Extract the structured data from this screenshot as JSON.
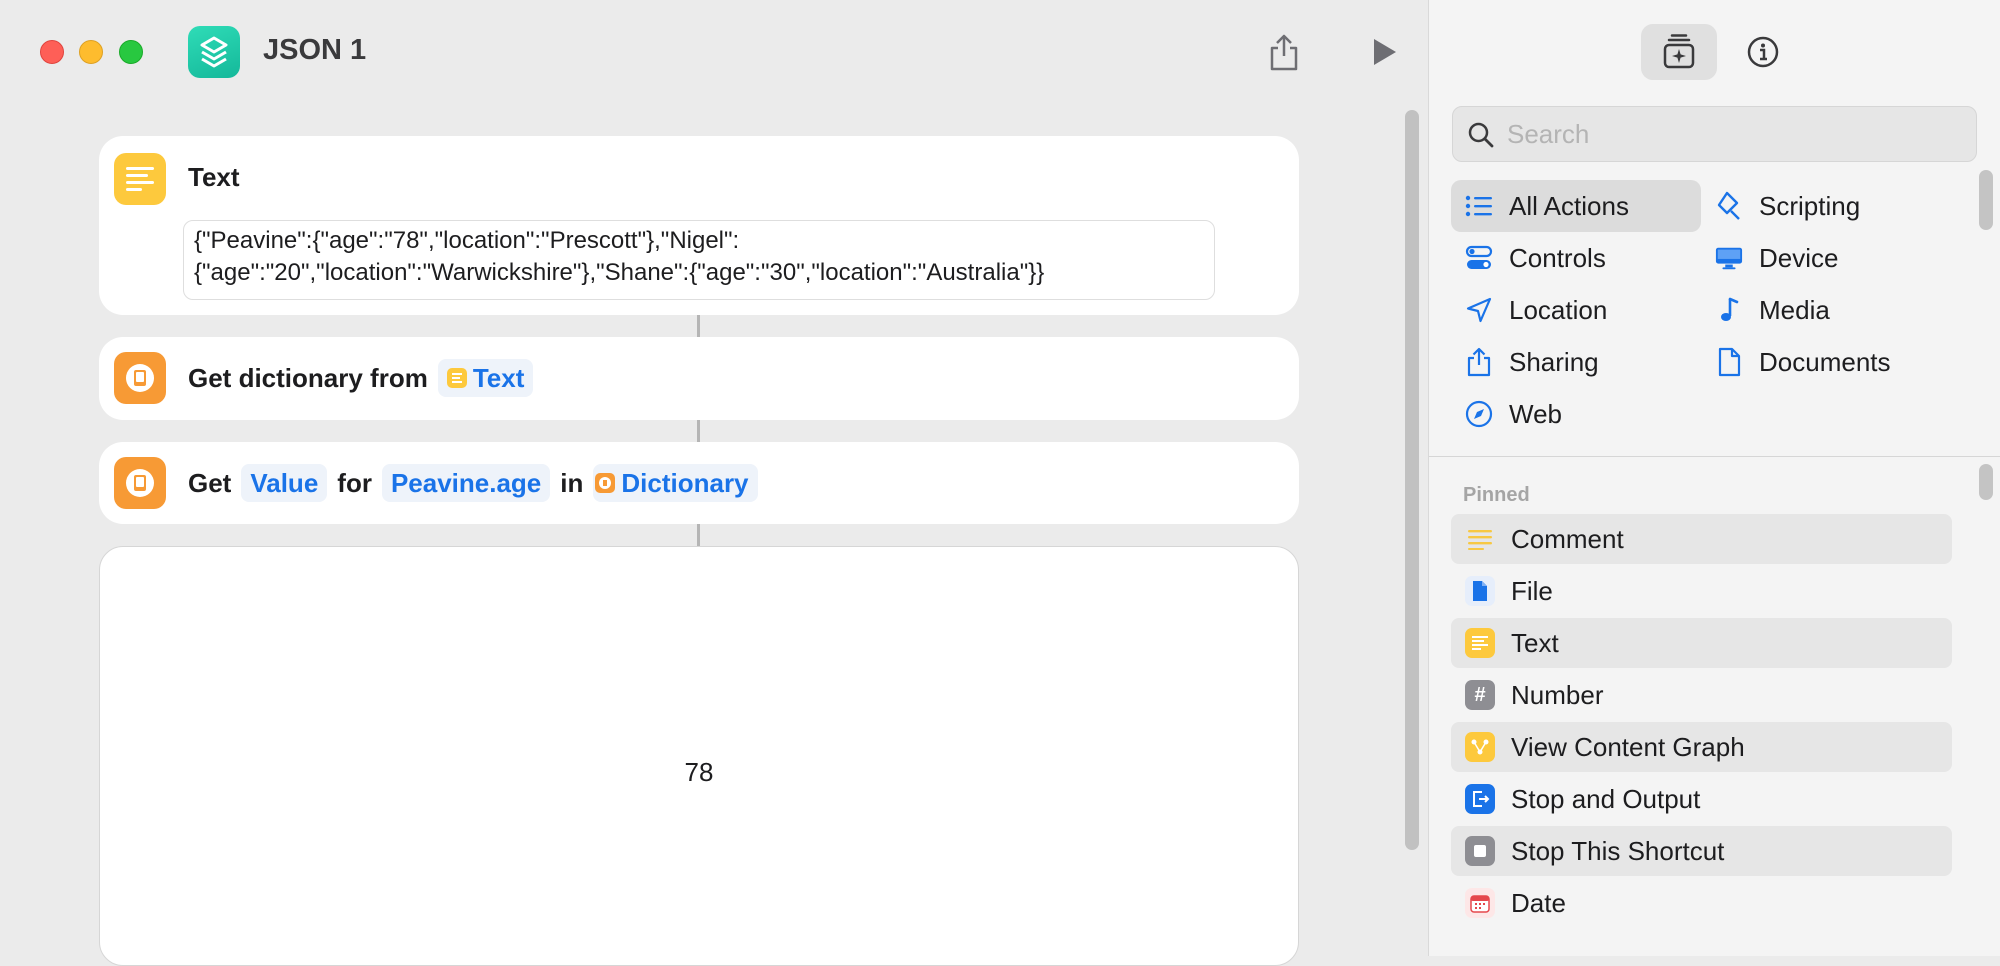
{
  "window": {
    "title": "JSON 1"
  },
  "editor": {
    "text_action": {
      "title": "Text",
      "content": "{\"Peavine\":{\"age\":\"78\",\"location\":\"Prescott\"},\"Nigel\":{\"age\":\"20\",\"location\":\"Warwickshire\"},\"Shane\":{\"age\":\"30\",\"location\":\"Australia\"}}"
    },
    "dict_action": {
      "label": "Get dictionary from",
      "token": "Text"
    },
    "value_action": {
      "get": "Get",
      "value_token": "Value",
      "for": "for",
      "key_token": "Peavine.age",
      "in": "in",
      "dict_token": "Dictionary"
    },
    "result": {
      "value": "78"
    }
  },
  "sidebar": {
    "search_placeholder": "Search",
    "categories": [
      {
        "label": "All Actions",
        "icon": "list-icon",
        "selected": true
      },
      {
        "label": "Scripting",
        "icon": "scripting-icon"
      },
      {
        "label": "Controls",
        "icon": "toggle-icon"
      },
      {
        "label": "Device",
        "icon": "display-icon"
      },
      {
        "label": "Location",
        "icon": "location-arrow-icon"
      },
      {
        "label": "Media",
        "icon": "music-note-icon"
      },
      {
        "label": "Sharing",
        "icon": "share-icon"
      },
      {
        "label": "Documents",
        "icon": "document-icon"
      },
      {
        "label": "Web",
        "icon": "compass-icon"
      }
    ],
    "pinned_header": "Pinned",
    "pinned": [
      {
        "label": "Comment",
        "icon": "comment-lines-icon",
        "color": "#f7c843"
      },
      {
        "label": "File",
        "icon": "file-icon",
        "color": "#1a73e8"
      },
      {
        "label": "Text",
        "icon": "text-lines-icon",
        "color": "#f7c843"
      },
      {
        "label": "Number",
        "icon": "hash-icon",
        "color": "#8e8e93"
      },
      {
        "label": "View Content Graph",
        "icon": "graph-icon",
        "color": "#f7c843"
      },
      {
        "label": "Stop and Output",
        "icon": "output-icon",
        "color": "#1a73e8"
      },
      {
        "label": "Stop This Shortcut",
        "icon": "stop-icon",
        "color": "#8e8e93"
      },
      {
        "label": "Date",
        "icon": "calendar-icon",
        "color": "#e5484d"
      }
    ]
  }
}
